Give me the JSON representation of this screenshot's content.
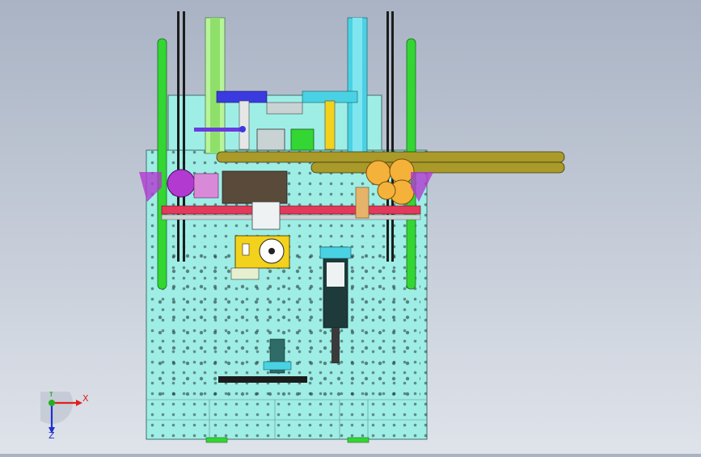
{
  "viewport": {
    "background_top": "#a9b3c4",
    "background_bottom": "#dfe3ea"
  },
  "colors": {
    "base_plate": "#9eeee6",
    "base_plate_edge": "#3f6f6c",
    "hole": "#3a3a3a",
    "green_rail": "#33d633",
    "cyan_column": "#49d2e4",
    "black_rod": "#1c1c1c",
    "olive_bar": "#a99a2a",
    "orange_gear": "#f4b23a",
    "magenta": "#b23ad0",
    "red_rail": "#e23a5a",
    "yellow_panel": "#f2d21c",
    "dark_teal": "#2f6b67",
    "blue": "#3a3ae0"
  },
  "triad": {
    "x_label": "X",
    "y_label": "Y",
    "z_label": "Z",
    "x_color": "#e02020",
    "y_color": "#20b020",
    "z_color": "#2030d0"
  }
}
